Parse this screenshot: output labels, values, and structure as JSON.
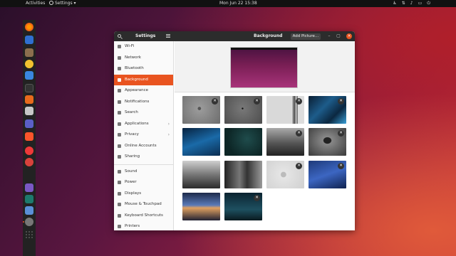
{
  "topbar": {
    "activities": "Activities",
    "app_menu": "Settings ▾",
    "clock": "Mon Jun 22  15:38",
    "tray_icons": [
      "accessibility-icon",
      "network-icon",
      "volume-icon",
      "battery-icon",
      "power-icon"
    ]
  },
  "dock": {
    "icons": [
      "firefox-icon",
      "mail-icon",
      "files-icon",
      "rhythmbox-icon",
      "writer-icon",
      "terminal-icon",
      "software-icon",
      "photos-icon",
      "teams-icon",
      "brave-icon",
      "vivaldi-icon",
      "image-viewer-icon",
      "text-editor-icon",
      "calculator-icon",
      "settings-icon",
      "app-grid-icon"
    ]
  },
  "window": {
    "sidebar_title": "Settings",
    "panel_title": "Background",
    "add_picture": "Add Picture…",
    "minimize": "–",
    "maximize": "▢",
    "close": "✕"
  },
  "sidebar": {
    "items": [
      {
        "label": "Wi-Fi",
        "icon": "wifi-icon"
      },
      {
        "label": "Network",
        "icon": "network-icon"
      },
      {
        "label": "Bluetooth",
        "icon": "bluetooth-icon"
      },
      {
        "label": "Background",
        "icon": "background-icon",
        "active": true
      },
      {
        "label": "Appearance",
        "icon": "appearance-icon"
      },
      {
        "label": "Notifications",
        "icon": "notifications-icon"
      },
      {
        "label": "Search",
        "icon": "search-icon"
      },
      {
        "label": "Applications",
        "icon": "applications-icon",
        "chevron": "›"
      },
      {
        "label": "Privacy",
        "icon": "privacy-icon",
        "chevron": "›"
      },
      {
        "label": "Online Accounts",
        "icon": "online-accounts-icon"
      },
      {
        "label": "Sharing",
        "icon": "sharing-icon"
      },
      {
        "label": "Sound",
        "icon": "sound-icon"
      },
      {
        "label": "Power",
        "icon": "power-icon"
      },
      {
        "label": "Displays",
        "icon": "displays-icon"
      },
      {
        "label": "Mouse & Touchpad",
        "icon": "mouse-icon"
      },
      {
        "label": "Keyboard Shortcuts",
        "icon": "keyboard-icon"
      },
      {
        "label": "Printers",
        "icon": "printer-icon"
      }
    ]
  },
  "wallpapers": {
    "remove_symbol": "✕",
    "items": [
      {
        "name": "apple-gray",
        "removable": true
      },
      {
        "name": "gray-dot",
        "removable": true
      },
      {
        "name": "light-barcode",
        "removable": true
      },
      {
        "name": "blue-circuit",
        "removable": true
      },
      {
        "name": "blue-cyber-lock",
        "removable": false
      },
      {
        "name": "dark-teal-abstract",
        "removable": false
      },
      {
        "name": "bw-road",
        "removable": true
      },
      {
        "name": "bw-tree",
        "removable": true
      },
      {
        "name": "bw-bridge",
        "removable": false
      },
      {
        "name": "bw-street",
        "removable": false
      },
      {
        "name": "light-gray-logo",
        "removable": true
      },
      {
        "name": "blue-mountains",
        "removable": true
      },
      {
        "name": "dusk-lake",
        "removable": false
      },
      {
        "name": "night-street",
        "removable": true
      }
    ]
  }
}
